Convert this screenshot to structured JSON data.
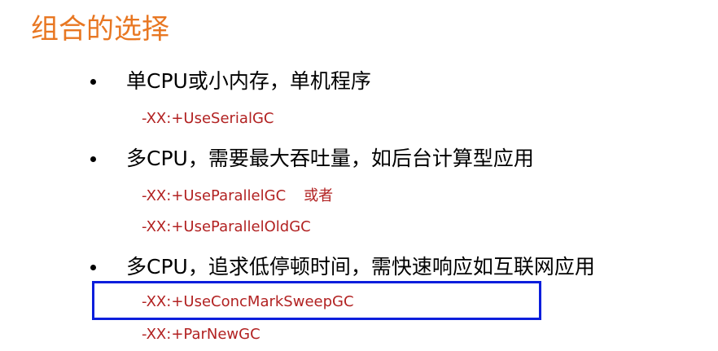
{
  "title": "组合的选择",
  "colors": {
    "title": "#e87722",
    "option_text": "#b22222",
    "highlight_border": "#0a1edc",
    "body_text": "#000000"
  },
  "sections": [
    {
      "bullet": "单CPU或小内存，单机程序",
      "options": [
        "-XX:+UseSerialGC"
      ]
    },
    {
      "bullet": "多CPU，需要最大吞吐量，如后台计算型应用",
      "options": [
        "-XX:+UseParallelGC",
        "-XX:+UseParallelOldGC"
      ],
      "or_word": "或者"
    },
    {
      "bullet": "多CPU，追求低停顿时间，需快速响应如互联网应用",
      "options": [
        "-XX:+UseConcMarkSweepGC",
        "-XX:+ParNewGC"
      ]
    }
  ]
}
